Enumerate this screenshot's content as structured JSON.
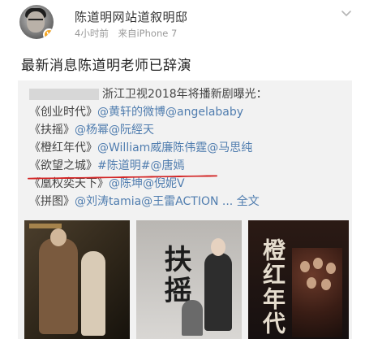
{
  "post": {
    "author": "陈道明网站道叙明邸",
    "time": "4小时前",
    "source": "来自iPhone 7",
    "text": "最新消息陈道明老师已辞演",
    "verified_badge": "V"
  },
  "repost": {
    "intro": "浙江卫视2018年将播新剧曝光：",
    "items": [
      {
        "title": "《创业时代》",
        "tags": "@黄轩的微博@angelababy"
      },
      {
        "title": "《扶摇》",
        "tags": "@杨幂@阮經天"
      },
      {
        "title": "《橙红年代》",
        "tags": "@William威廉陈伟霆@马思纯"
      },
      {
        "title": "《欲望之城》",
        "tags": "#陈道明#@唐嫣"
      },
      {
        "title": "《凰权奕天下》",
        "tags": "@陈坤@倪妮V"
      },
      {
        "title": "《拼图》",
        "tags": "@刘涛tamia@王雷ACTION ...",
        "more": "全文"
      }
    ],
    "posters": [
      {
        "name": "poster-1",
        "caption": ""
      },
      {
        "name": "poster-2",
        "caption": "扶摇"
      },
      {
        "name": "poster-3",
        "caption": "橙红年代"
      }
    ]
  },
  "colors": {
    "link": "#507daf",
    "highlight": "#d32424",
    "meta": "#9a9a9a"
  },
  "icons": {
    "menu": "chevron-down-icon",
    "verified": "verified-badge-icon"
  }
}
